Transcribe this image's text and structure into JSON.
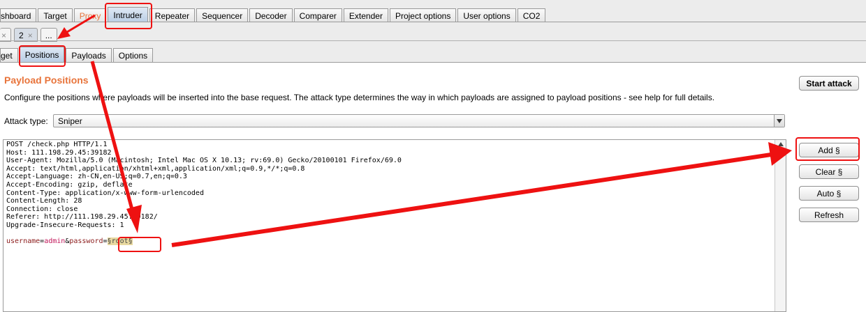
{
  "main_tabs": [
    "shboard",
    "Target",
    "Proxy",
    "Intruder",
    "Repeater",
    "Sequencer",
    "Decoder",
    "Comparer",
    "Extender",
    "Project options",
    "User options",
    "CO2"
  ],
  "active_main_tab": "Intruder",
  "request_tabs": [
    {
      "label": "",
      "close": "×"
    },
    {
      "label": "2",
      "close": "×"
    },
    {
      "label": "...",
      "close": ""
    }
  ],
  "sub_tabs": [
    "get",
    "Positions",
    "Payloads",
    "Options"
  ],
  "active_sub_tab": "Positions",
  "payload_positions": {
    "title": "Payload Positions",
    "description": "Configure the positions where payloads will be inserted into the base request. The attack type determines the way in which payloads are assigned to payload positions - see help for full details.",
    "attack_type_label": "Attack type:",
    "attack_type_value": "Sniper"
  },
  "request": {
    "lines": [
      "POST /check.php HTTP/1.1",
      "Host: 111.198.29.45:39182",
      "User-Agent: Mozilla/5.0 (Macintosh; Intel Mac OS X 10.13; rv:69.0) Gecko/20100101 Firefox/69.0",
      "Accept: text/html,application/xhtml+xml,application/xml;q=0.9,*/*;q=0.8",
      "Accept-Language: zh-CN,en-US;q=0.7,en;q=0.3",
      "Accept-Encoding: gzip, deflate",
      "Content-Type: application/x-www-form-urlencoded",
      "Content-Length: 28",
      "Connection: close",
      "Referer: http://111.198.29.45:39182/",
      "Upgrade-Insecure-Requests: 1"
    ],
    "body": {
      "param1_name": "username",
      "eq1": "=",
      "param1_value": "admin",
      "amp": "&",
      "param2_name": "password",
      "eq2": "=",
      "marker": "§root§"
    }
  },
  "buttons": {
    "start_attack": "Start attack",
    "add": "Add §",
    "clear": "Clear §",
    "auto": "Auto §",
    "refresh": "Refresh"
  },
  "colors": {
    "accent_orange": "#e8743b",
    "annotation_red": "#ee1111",
    "param_name": "#8b1a1a",
    "param_value": "#c2185b"
  }
}
